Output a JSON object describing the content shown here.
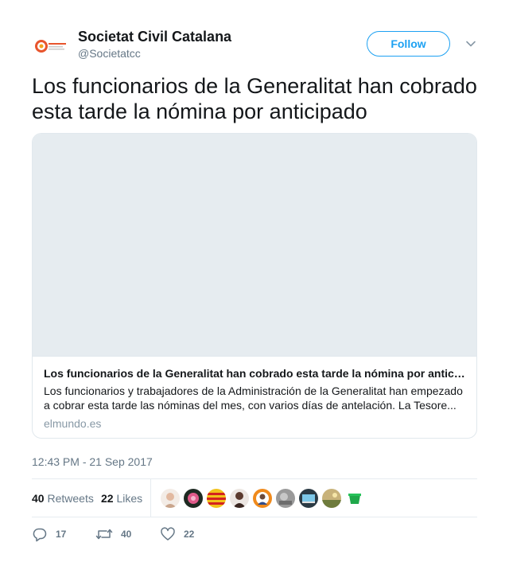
{
  "user": {
    "display_name": "Societat Civil Catalana",
    "handle": "@Societatcc",
    "avatar_icon": "scc-logo-icon"
  },
  "follow_label": "Follow",
  "tweet_text": "Los funcionarios de la Generalitat han cobrado esta tarde la nómina por anticipado",
  "card": {
    "title": "Los funcionarios de la Generalitat han cobrado esta tarde la nómina por anticipado",
    "description": "Los funcionarios y trabajadores de la Administración de la Generalitat han empezado a cobrar esta tarde las nóminas del mes, con varios días de antelación. La Tesore...",
    "domain": "elmundo.es"
  },
  "timestamp": "12:43 PM - 21 Sep 2017",
  "stats": {
    "retweets_count": "40",
    "retweets_label": "Retweets",
    "likes_count": "22",
    "likes_label": "Likes"
  },
  "actions": {
    "reply_count": "17",
    "retweet_count": "40",
    "like_count": "22"
  },
  "colors": {
    "accent": "#1da1f2",
    "secondary_text": "#657786",
    "border": "#e1e8ed"
  }
}
